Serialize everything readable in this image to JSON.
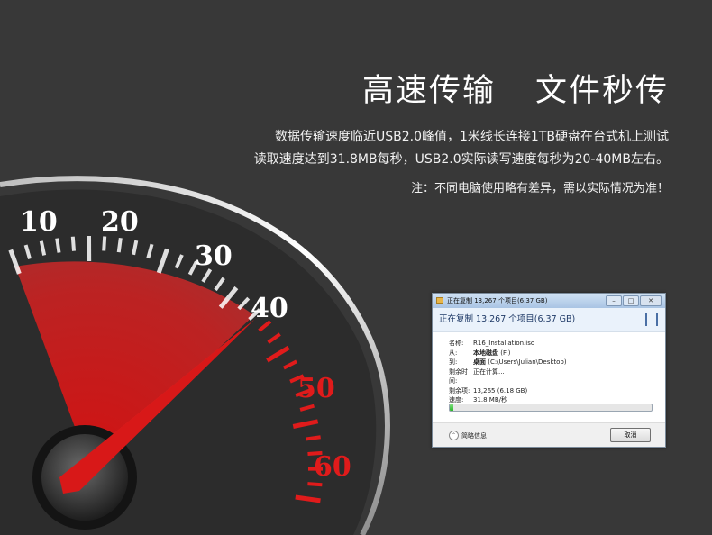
{
  "headline": {
    "left": "高速传输",
    "right": "文件秒传"
  },
  "description": {
    "line1": "数据传输速度临近USB2.0峰值，1米线长连接1TB硬盘在台式机上测试",
    "line2": "读取速度达到31.8MB每秒，USB2.0实际读写速度每秒为20-40MB左右。"
  },
  "note": "注：不同电脑使用略有差异，需以实际情况为准！",
  "gauge": {
    "labels": [
      "10",
      "20",
      "30",
      "40",
      "50",
      "60"
    ],
    "needle_value": 40,
    "colors": {
      "white_ticks": "#ffffff",
      "red_ticks": "#e01b1b",
      "needle": "#d81818"
    }
  },
  "dialog": {
    "title": "正在复制 13,267 个项目(6.37 GB)",
    "window_buttons": [
      "–",
      "□",
      "✕"
    ],
    "header": "正在复制 13,267 个项目(6.37 GB)",
    "rows": [
      {
        "key": "名称:",
        "value": "R16_Installation.iso"
      },
      {
        "key": "从:",
        "value_bold": "本地磁盘",
        "value": " (F:)"
      },
      {
        "key": "到:",
        "value_bold": "桌面",
        "value": " (C:\\Users\\Julian\\Desktop)"
      },
      {
        "key": "剩余时间:",
        "value": "正在计算..."
      },
      {
        "key": "剩余项:",
        "value": "13,265 (6.18 GB)"
      },
      {
        "key": "速度:",
        "value": "31.8 MB/秒"
      }
    ],
    "progress": 0.02,
    "more_info": "简略信息",
    "cancel": "取消"
  }
}
